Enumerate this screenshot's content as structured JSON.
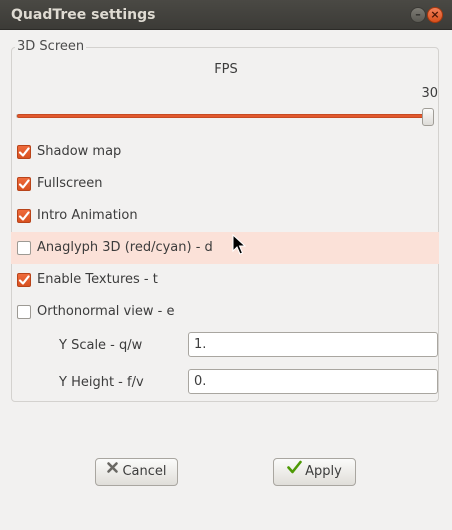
{
  "window": {
    "title": "QuadTree settings",
    "minimize_glyph": "–",
    "close_glyph": "×"
  },
  "frame": {
    "label": "3D Screen"
  },
  "fps": {
    "label": "FPS",
    "value": "30",
    "fraction": 1.0
  },
  "options": [
    {
      "label": "Shadow map",
      "checked": true
    },
    {
      "label": "Fullscreen",
      "checked": true
    },
    {
      "label": "Intro Animation",
      "checked": true
    },
    {
      "label": "Anaglyph 3D (red/cyan) - d",
      "checked": false,
      "hovered": true
    },
    {
      "label": "Enable Textures - t",
      "checked": true
    },
    {
      "label": "Orthonormal view - e",
      "checked": false
    }
  ],
  "fields": [
    {
      "label": "Y Scale - q/w",
      "value": "1."
    },
    {
      "label": "Y Height - f/v",
      "value": "0."
    }
  ],
  "buttons": {
    "cancel_label": "Cancel",
    "apply_label": "Apply"
  },
  "icons": {
    "checkbox_checked": "checkmark-icon",
    "cancel": "x-icon",
    "apply": "checkmark-icon",
    "pointer": "mouse-pointer-icon"
  },
  "colors": {
    "accent": "#e2592e",
    "hover_row": "#fbe1d8",
    "titlebar": "#3c3b37"
  }
}
